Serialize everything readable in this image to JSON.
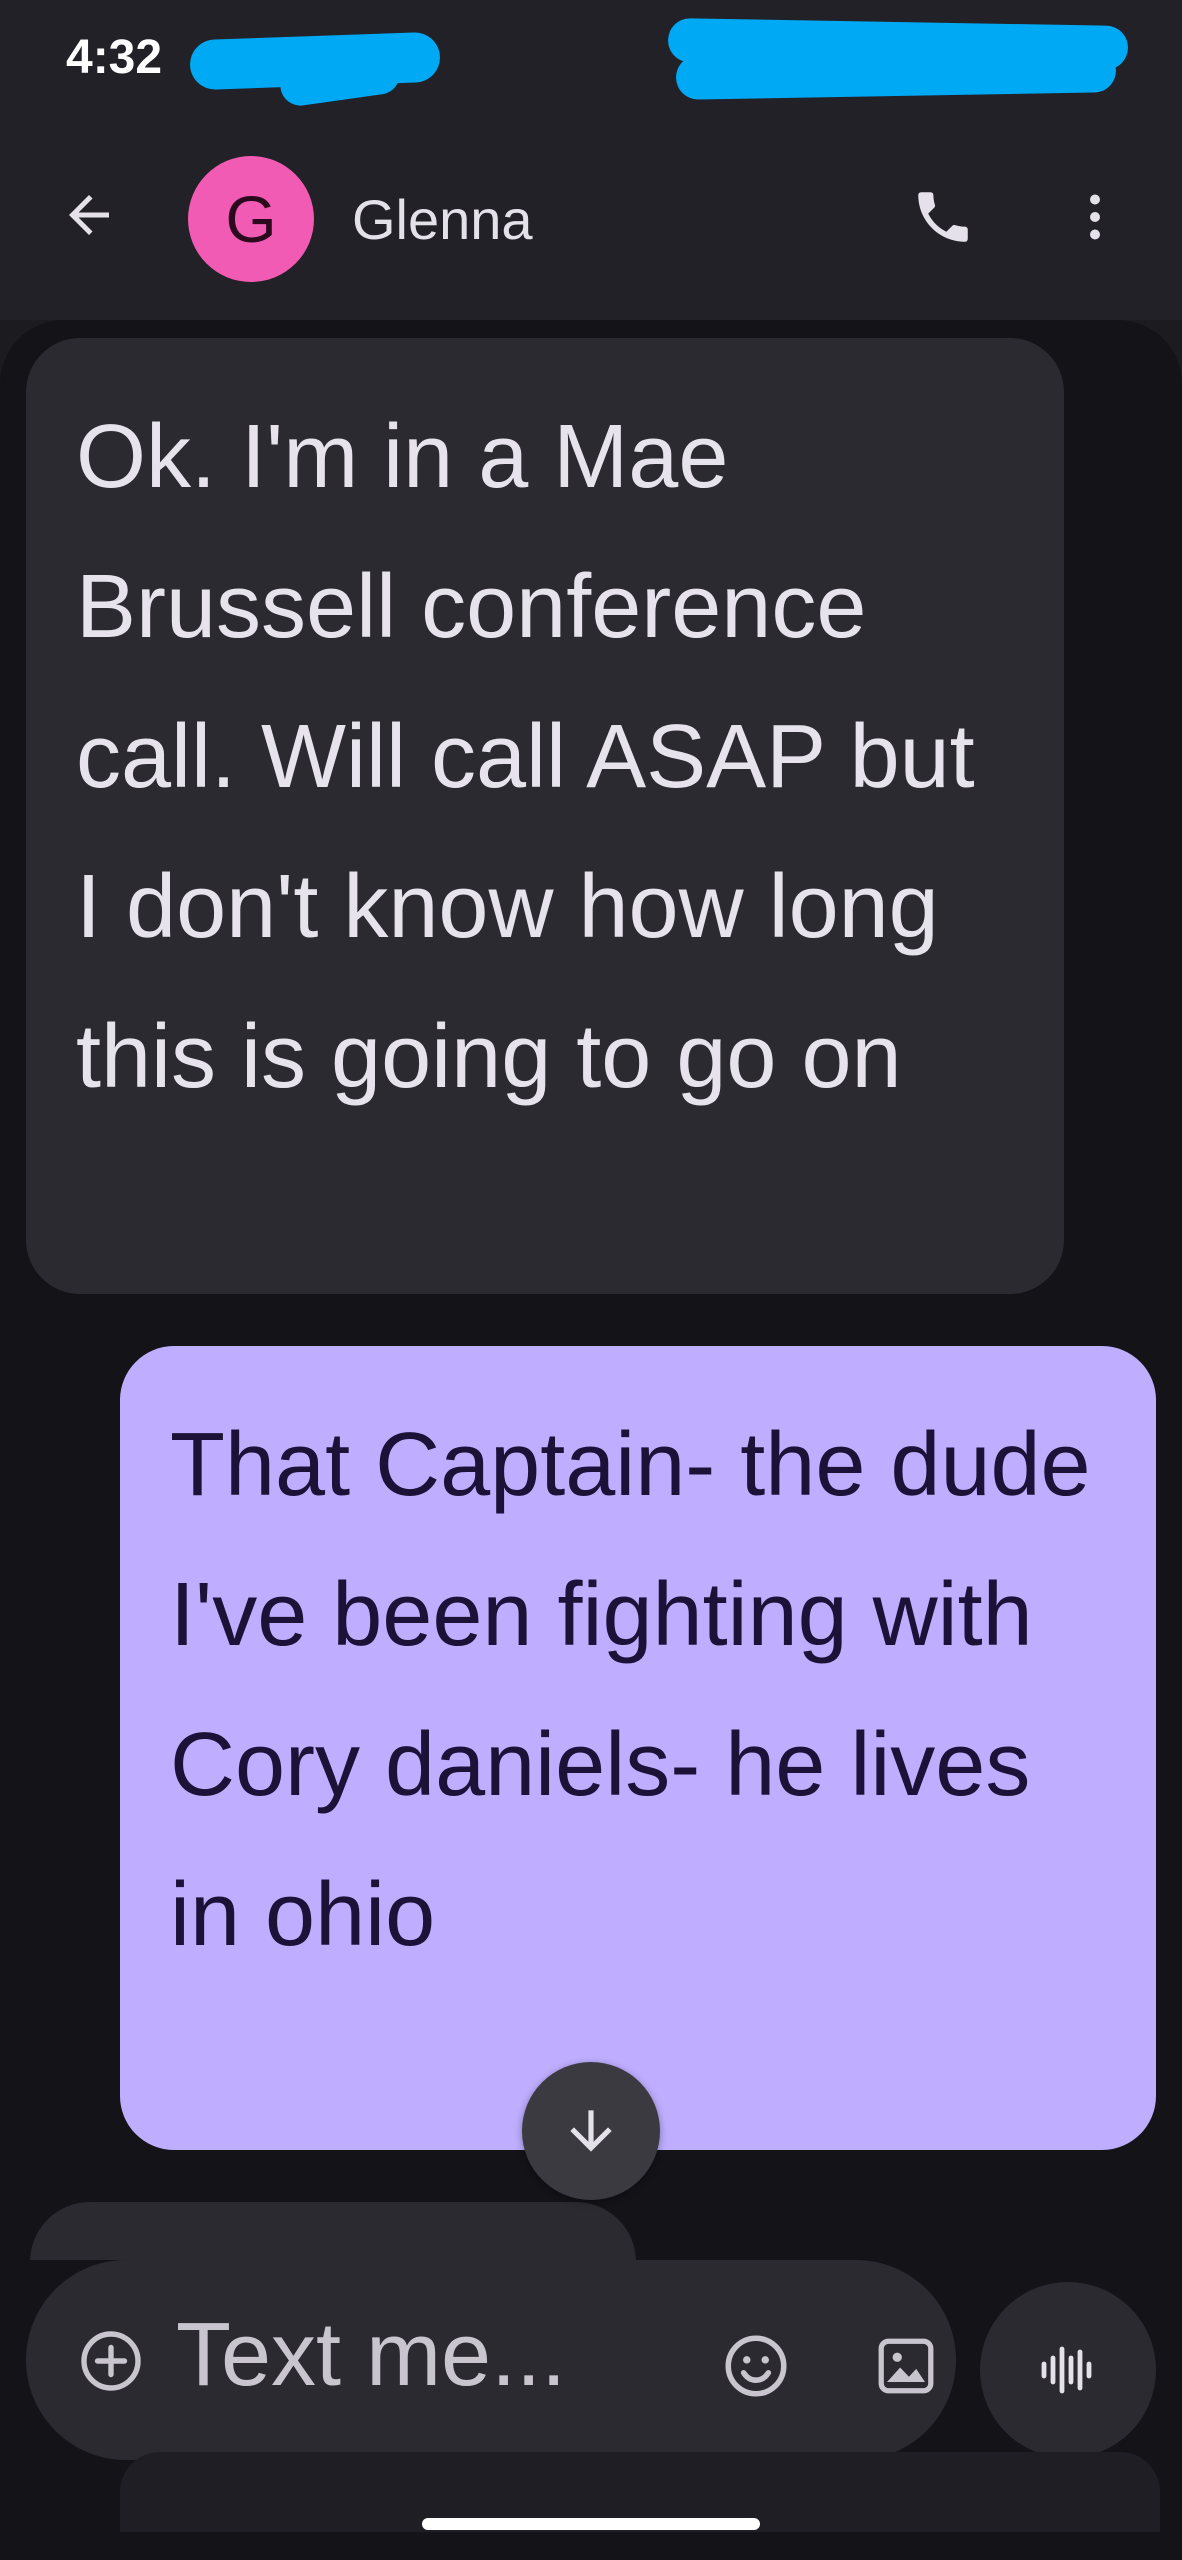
{
  "status_bar": {
    "time": "4:32"
  },
  "header": {
    "back_icon": "arrow-back-icon",
    "avatar_initial": "G",
    "avatar_color": "#f25bb3",
    "contact_name": "Glenna",
    "call_icon": "phone-icon",
    "more_icon": "more-vert-icon"
  },
  "messages": [
    {
      "direction": "received",
      "text": "Ok. I'm in a Mae Brussell conference call. Will call ASAP but I don't know how long this is going to go on",
      "bubble_color": "#2b2a30"
    },
    {
      "direction": "sent",
      "text": "That Captain- the dude I've been fighting with Cory daniels- he lives in ohio",
      "bubble_color": "#bfaeff"
    }
  ],
  "scroll_down_icon": "arrow-down-icon",
  "compose": {
    "add_icon": "add-circle-icon",
    "placeholder": "Text me...",
    "emoji_icon": "emoji-icon",
    "gallery_icon": "gallery-icon",
    "voice_icon": "voice-waveform-icon"
  },
  "colors": {
    "redaction": "#00a9f4",
    "background": "#1c1b20",
    "accent": "#bfaeff"
  }
}
